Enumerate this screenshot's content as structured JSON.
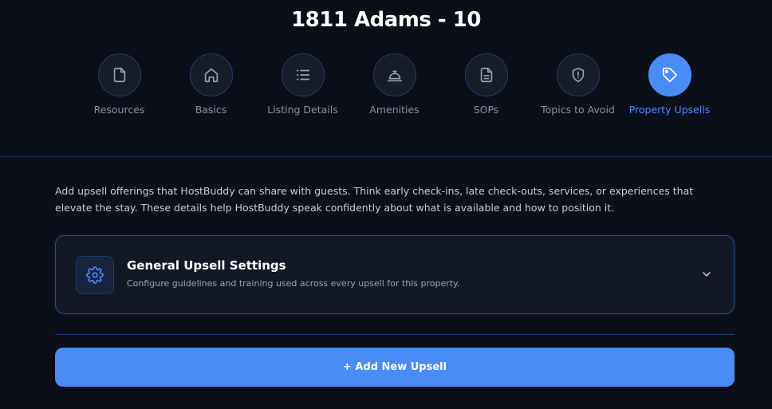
{
  "page_title": "1811 Adams - 10",
  "steps": [
    {
      "label": "Resources",
      "icon": "file-icon",
      "active": false
    },
    {
      "label": "Basics",
      "icon": "home-icon",
      "active": false
    },
    {
      "label": "Listing Details",
      "icon": "list-icon",
      "active": false
    },
    {
      "label": "Amenities",
      "icon": "service-bell-icon",
      "active": false
    },
    {
      "label": "SOPs",
      "icon": "document-lines-icon",
      "active": false
    },
    {
      "label": "Topics to Avoid",
      "icon": "shield-alert-icon",
      "active": false
    },
    {
      "label": "Property Upsells",
      "icon": "tag-icon",
      "active": true
    }
  ],
  "description": "Add upsell offerings that HostBuddy can share with guests. Think early check-ins, late check-outs, services, or experiences that elevate the stay. These details help HostBuddy speak confidently about what is available and how to position it.",
  "general_settings": {
    "title": "General Upsell Settings",
    "subtitle": "Configure guidelines and training used across every upsell for this property.",
    "icon": "gear-icon",
    "expand_icon": "chevron-down-icon"
  },
  "add_button_label": "+ Add New Upsell",
  "colors": {
    "background": "#0b0f19",
    "accent": "#4a8cf6",
    "card_border": "#2a4c8a"
  }
}
